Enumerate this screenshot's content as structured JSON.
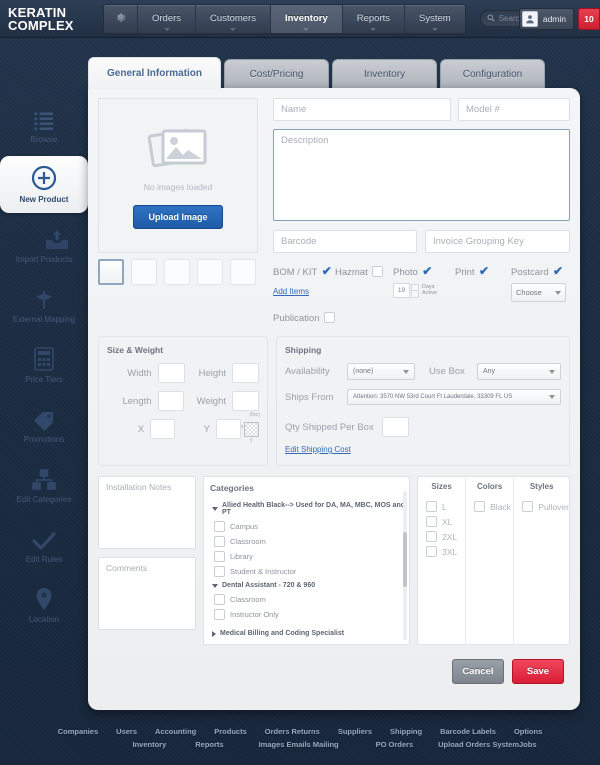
{
  "brand": {
    "line1": "KERATIN",
    "line2": "COMPLEX"
  },
  "topnav": {
    "gear_icon": "gear-icon",
    "items": [
      {
        "label": "Orders",
        "active": false
      },
      {
        "label": "Customers",
        "active": false
      },
      {
        "label": "Inventory",
        "active": true
      },
      {
        "label": "Reports",
        "active": false
      },
      {
        "label": "System",
        "active": false
      }
    ],
    "search": {
      "placeholder": "Search",
      "value": "",
      "icon": "search-icon"
    },
    "user": {
      "name": "admin",
      "avatar_icon": "user-avatar-icon"
    },
    "notification_count": "10"
  },
  "sidebar": {
    "items": [
      {
        "label": "Browse",
        "icon": "list-icon",
        "active": false
      },
      {
        "label": "New Product",
        "icon": "plus-circle-icon",
        "active": true
      },
      {
        "label": "Import Products",
        "icon": "import-arrow-icon",
        "active": false
      },
      {
        "label": "External Mapping",
        "icon": "mapping-flag-icon",
        "active": false
      },
      {
        "label": "Price Tiers",
        "icon": "calculator-icon",
        "active": false
      },
      {
        "label": "Promotions",
        "icon": "tag-icon",
        "active": false
      },
      {
        "label": "Edit Categories",
        "icon": "hierarchy-icon",
        "active": false
      },
      {
        "label": "Edit Rules",
        "icon": "check-icon",
        "active": false
      },
      {
        "label": "Location",
        "icon": "map-pin-icon",
        "active": false
      }
    ]
  },
  "tabs": [
    {
      "label": "General Information",
      "active": true
    },
    {
      "label": "Cost/Pricing",
      "active": false
    },
    {
      "label": "Inventory",
      "active": false
    },
    {
      "label": "Configuration",
      "active": false
    }
  ],
  "media": {
    "empty_text": "No images loaded",
    "upload_label": "Upload Image",
    "placeholder_icon": "image-placeholder-icon",
    "thumbnail_count": 5
  },
  "fields": {
    "name": {
      "placeholder": "Name",
      "value": ""
    },
    "model": {
      "placeholder": "Model #",
      "value": ""
    },
    "description": {
      "placeholder": "Description",
      "value": ""
    },
    "barcode": {
      "placeholder": "Barcode",
      "value": ""
    },
    "invoice_grouping_key": {
      "placeholder": "Invoice Grouping Key",
      "value": ""
    }
  },
  "flags": {
    "bom_kit": {
      "label": "BOM / KIT",
      "checked": true,
      "sublink": "Add Items"
    },
    "hazmat": {
      "label": "Hazmat",
      "checked": false
    },
    "photo": {
      "label": "Photo",
      "checked": true,
      "days_value": "19",
      "days_label_1": "Days",
      "days_label_2": "Active"
    },
    "print": {
      "label": "Print",
      "checked": true
    },
    "postcard": {
      "label": "Postcard",
      "checked": true,
      "select_value": "Choose"
    },
    "publication": {
      "label": "Publication",
      "checked": false
    }
  },
  "size_weight": {
    "title": "Size & Weight",
    "width": {
      "label": "Width",
      "value": ""
    },
    "height": {
      "label": "Height",
      "value": ""
    },
    "length": {
      "label": "Length",
      "value": ""
    },
    "weight": {
      "label": "Weight",
      "value": "",
      "unit": "(lbs)"
    },
    "x": {
      "label": "X",
      "value": ""
    },
    "y": {
      "label": "Y",
      "value": ""
    },
    "axis_x": "x",
    "axis_y": "y"
  },
  "shipping": {
    "title": "Shipping",
    "availability": {
      "label": "Availability",
      "value": "(none)"
    },
    "use_box": {
      "label": "Use Box",
      "value": "Any"
    },
    "ships_from": {
      "label": "Ships From",
      "value": "Attention: 3570 NW 53rd Court Ft Lauderdale, 33309 FL US"
    },
    "qty_per_box": {
      "label": "Qty  Shipped Per Box",
      "value": ""
    },
    "edit_cost_link": "Edit Shipping Cost"
  },
  "notes": {
    "installation": {
      "placeholder": "Installation Notes",
      "value": ""
    },
    "comments": {
      "placeholder": "Comments",
      "value": ""
    }
  },
  "categories": {
    "title": "Categories",
    "groups": [
      {
        "label": "Allied Health Black--> Used for DA, MA, MBC, MOS and PT",
        "expanded": true,
        "items": [
          {
            "label": "Campus",
            "checked": false
          },
          {
            "label": "Classroom",
            "checked": false
          },
          {
            "label": "Library",
            "checked": false
          },
          {
            "label": "Student & Instructor",
            "checked": false
          }
        ]
      },
      {
        "label": "Dental Assistant - 720 & 960",
        "expanded": true,
        "items": [
          {
            "label": "Classroom",
            "checked": false
          },
          {
            "label": "Instructor Only",
            "checked": false
          }
        ]
      },
      {
        "label": "Medical Billing and Coding Specialist",
        "expanded": false,
        "items": []
      }
    ]
  },
  "attributes": {
    "sizes": {
      "title": "Sizes",
      "options": [
        {
          "label": "L",
          "checked": false
        },
        {
          "label": "XL",
          "checked": false
        },
        {
          "label": "2XL",
          "checked": false
        },
        {
          "label": "3XL",
          "checked": false
        }
      ]
    },
    "colors": {
      "title": "Colors",
      "options": [
        {
          "label": "Black",
          "checked": false
        }
      ]
    },
    "styles": {
      "title": "Styles",
      "options": [
        {
          "label": "Pullover",
          "checked": false
        }
      ]
    }
  },
  "actions": {
    "cancel": "Cancel",
    "save": "Save"
  },
  "footer": {
    "row1": [
      "Companies",
      "Users",
      "Accounting",
      "Products",
      "Orders Returns",
      "Suppliers",
      "Shipping",
      "Barcode Labels",
      "Options"
    ],
    "row2": [
      "Inventory",
      "Reports",
      "Images Emails Mailing",
      "PO Orders",
      "Upload Orders SystemJobs"
    ]
  },
  "colors": {
    "accent": "#2f6cb5",
    "save": "#d91e36",
    "chrome": "#27374c",
    "backdrop": "#1b2c42"
  }
}
